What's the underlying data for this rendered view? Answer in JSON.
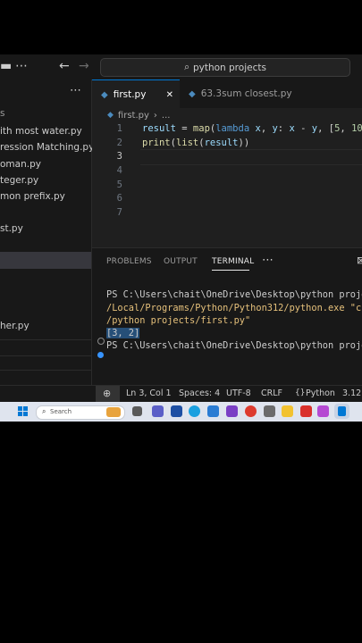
{
  "titlebar": {
    "more": "⋯",
    "back": "←",
    "forward": "→",
    "search_text": "python projects",
    "search_glyph": "⌕"
  },
  "sidebar": {
    "more": "⋯",
    "partial": "s",
    "items": [
      "ith most water.py",
      "ression Matching.py",
      "oman.py",
      "teger.py",
      "mon prefix.py",
      "st.py",
      "her.py"
    ]
  },
  "tabs": [
    {
      "label": "first.py",
      "active": true,
      "close": "✕"
    },
    {
      "label": "63.3sum closest.py",
      "active": false
    }
  ],
  "breadcrumb": {
    "file": "first.py",
    "sep": "›",
    "more": "..."
  },
  "editor": {
    "line_numbers": [
      "1",
      "2",
      "3",
      "4",
      "5",
      "6",
      "7"
    ],
    "lines": [
      "result = map(lambda x, y: x - y, [5, 10",
      "print(list(result))",
      "",
      "",
      "",
      "",
      ""
    ]
  },
  "panel": {
    "tabs": [
      "PROBLEMS",
      "OUTPUT",
      "TERMINAL"
    ],
    "active_tab": "TERMINAL",
    "more": "⋯",
    "terminal_lines": [
      "PS C:\\Users\\chait\\OneDrive\\Desktop\\python proje",
      "/Local/Programs/Python/Python312/python.exe \"c:",
      "/python projects/first.py\"",
      "[3, 2]",
      "PS C:\\Users\\chait\\OneDrive\\Desktop\\python proje"
    ]
  },
  "statusbar": {
    "zoom_glyph": "⊕",
    "position": "Ln 3, Col 1",
    "spaces": "Spaces: 4",
    "encoding": "UTF-8",
    "eol": "CRLF",
    "language": "Python",
    "version": "3.12.("
  },
  "taskbar": {
    "search_placeholder": "Search"
  },
  "colors": {
    "accent": "#0078d4",
    "string": "#ce9178",
    "keyword": "#569cd6",
    "function": "#dcdcaa",
    "number": "#b5cea8"
  }
}
